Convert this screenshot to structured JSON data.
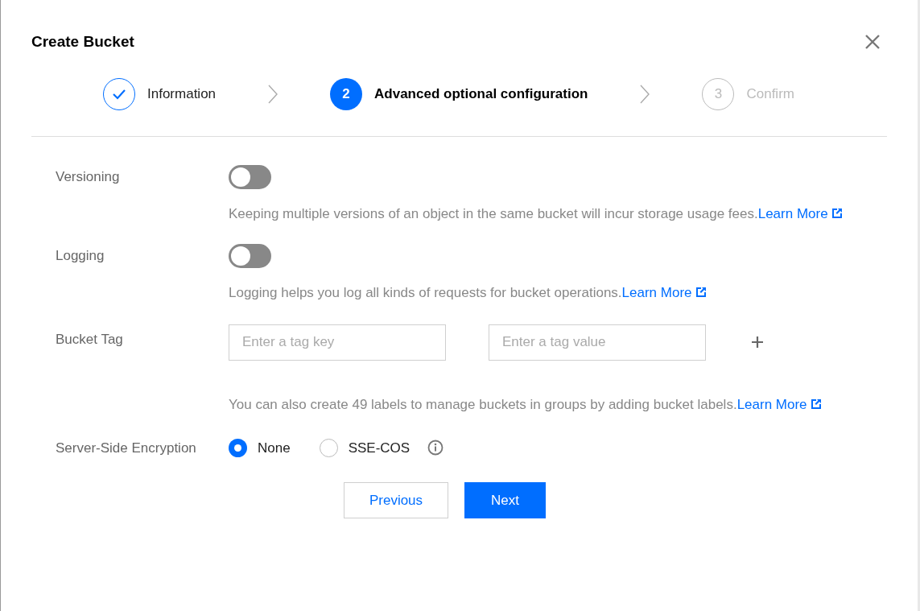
{
  "dialog": {
    "title": "Create Bucket"
  },
  "steps": [
    {
      "label": "Information",
      "kind": "done"
    },
    {
      "number": "2",
      "label": "Advanced optional configuration",
      "kind": "current"
    },
    {
      "number": "3",
      "label": "Confirm",
      "kind": "pending"
    }
  ],
  "versioning": {
    "label": "Versioning",
    "on": false,
    "description": "Keeping multiple versions of an object in the same bucket will incur storage usage fees.",
    "link": "Learn More"
  },
  "logging": {
    "label": "Logging",
    "on": false,
    "description": "Logging helps you log all kinds of requests for bucket operations.",
    "link": "Learn More"
  },
  "bucket_tag": {
    "label": "Bucket Tag",
    "key_placeholder": "Enter a tag key",
    "value_placeholder": "Enter a tag value",
    "description": "You can also create 49 labels to manage buckets in groups by adding bucket labels.",
    "link": "Learn More"
  },
  "encryption": {
    "label": "Server-Side Encryption",
    "options": [
      {
        "label": "None",
        "selected": true
      },
      {
        "label": "SSE-COS",
        "selected": false
      }
    ]
  },
  "buttons": [
    {
      "label": "Previous",
      "kind": "secondary"
    },
    {
      "label": "Next",
      "kind": "primary"
    }
  ]
}
